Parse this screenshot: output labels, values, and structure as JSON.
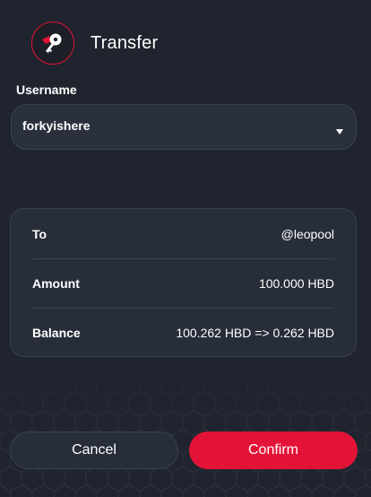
{
  "header": {
    "title": "Transfer",
    "logo_icon": "key-icon",
    "accent": "#e31337"
  },
  "username": {
    "label": "Username",
    "value": "forkyishere"
  },
  "details": [
    {
      "label": "To",
      "value": "@leopool"
    },
    {
      "label": "Amount",
      "value": "100.000 HBD"
    },
    {
      "label": "Balance",
      "value": "100.262 HBD => 0.262 HBD"
    }
  ],
  "actions": {
    "cancel": "Cancel",
    "confirm": "Confirm"
  }
}
